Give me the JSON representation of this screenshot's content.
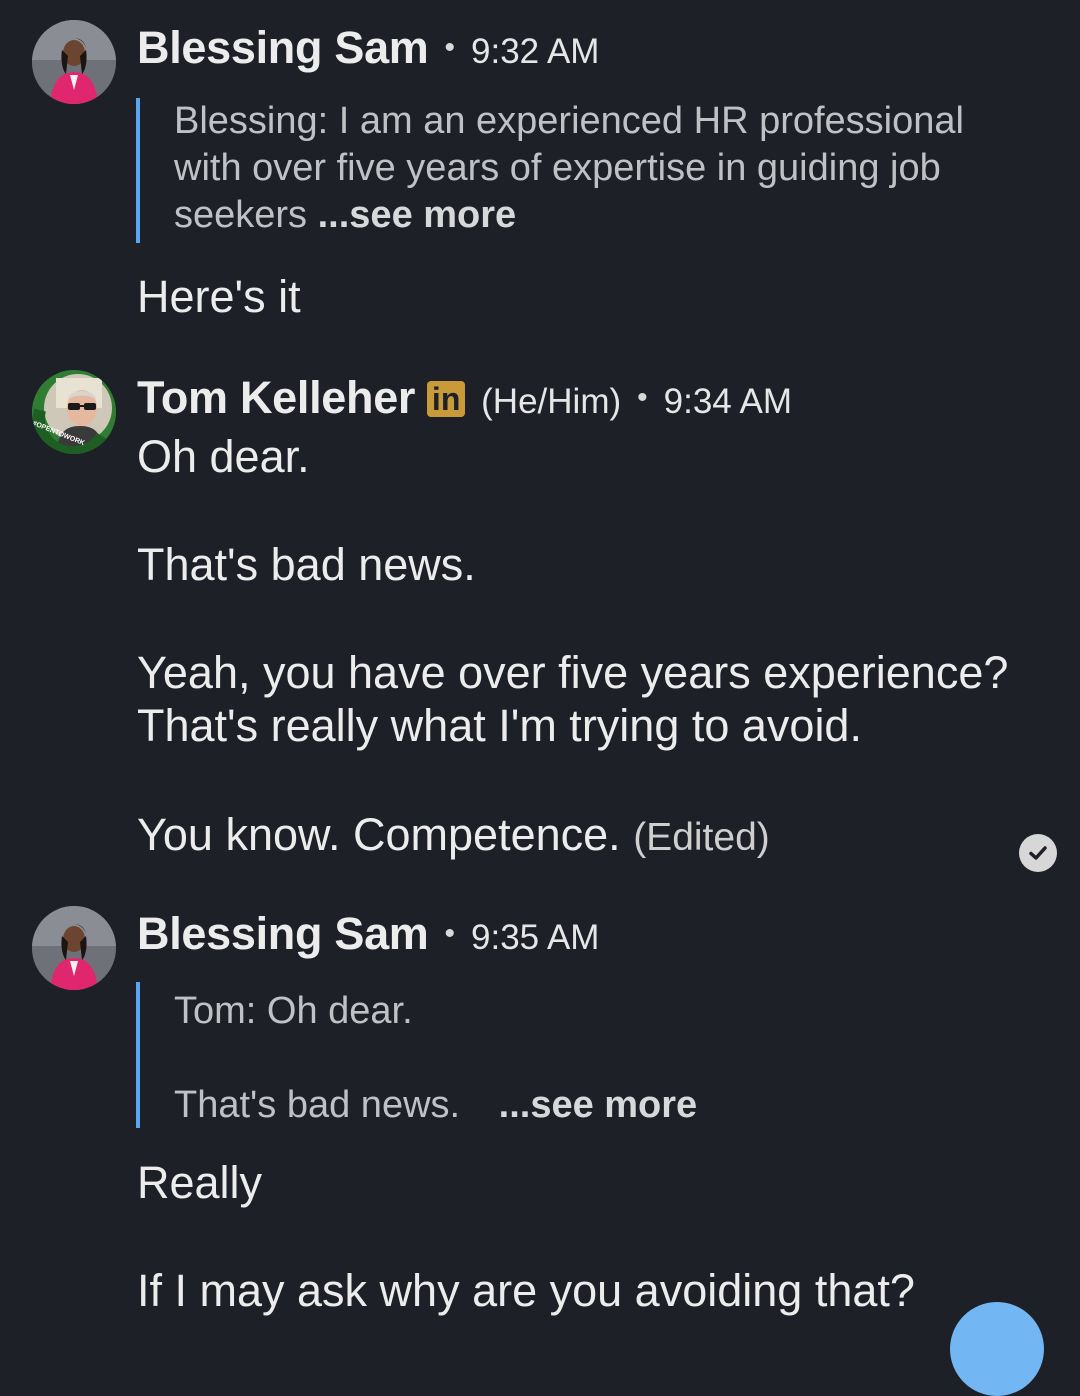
{
  "messages": [
    {
      "sender": "Blessing Sam",
      "time": "9:32 AM",
      "quote": {
        "text": "Blessing: I am an experienced HR professional with over five years of expertise in guiding job seekers",
        "more": "...see more"
      },
      "body": "Here's it"
    },
    {
      "sender": "Tom Kelleher",
      "badge": "in",
      "pronouns": "(He/Him)",
      "time": "9:34 AM",
      "avatar_ring_text": "#OPENTOWORK",
      "lines": [
        "Oh dear.",
        "That's bad news.",
        "Yeah, you have over five years experience?",
        "That's really what I'm trying to avoid.",
        "You know.  Competence."
      ],
      "edited": "(Edited)"
    },
    {
      "sender": "Blessing Sam",
      "time": "9:35 AM",
      "quote": {
        "line1": "Tom: Oh dear.",
        "line2": "That's bad news.",
        "more": "...see more"
      },
      "lines": [
        "Really",
        "If I may ask why are you avoiding that?"
      ]
    }
  ],
  "separator": "•",
  "icons": {
    "read_receipt": "check-circle-icon",
    "avatar_blessing": "profile-photo-woman-pink-blazer",
    "avatar_tom": "profile-photo-man-glasses-opentowork"
  },
  "colors": {
    "background": "#1d2026",
    "quote_bar": "#5aa6f0",
    "linkedin_badge": "#c99a3a",
    "opentowork_ring": "#2f7d32",
    "fab": "#72b6f4"
  }
}
